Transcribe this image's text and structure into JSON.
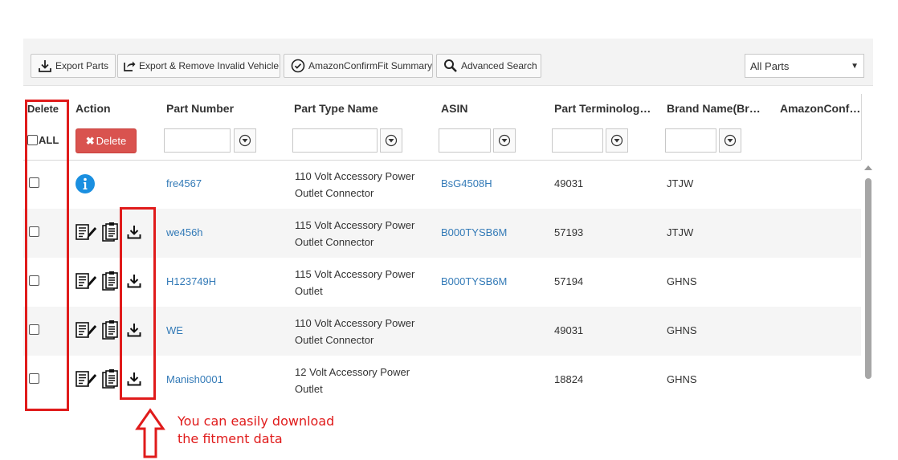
{
  "toolbar": {
    "export_parts": "Export Parts",
    "export_remove": "Export & Remove Invalid Vehicle",
    "amazon_summary": "AmazonConfirmFit Summary",
    "advanced_search": "Advanced Search",
    "filter_select": "All Parts"
  },
  "grid": {
    "columns": [
      "Delete",
      "Action",
      "Part Number",
      "Part Type Name",
      "ASIN",
      "Part Terminology…",
      "Brand Name(Bra…",
      "AmazonConfir…"
    ],
    "select_all_label": "ALL",
    "delete_button": "Delete",
    "rows": [
      {
        "part_number": "fre4567",
        "part_type": "110 Volt Accessory Power Outlet Connector",
        "asin": "BsG4508H",
        "terminology": "49031",
        "brand": "JTJW",
        "action": "info"
      },
      {
        "part_number": "we456h",
        "part_type": "115 Volt Accessory Power Outlet Connector",
        "asin": "B000TYSB6M",
        "terminology": "57193",
        "brand": "JTJW",
        "action": "tools"
      },
      {
        "part_number": "H123749H",
        "part_type": "115 Volt Accessory Power Outlet",
        "asin": "B000TYSB6M",
        "terminology": "57194",
        "brand": "GHNS",
        "action": "tools"
      },
      {
        "part_number": "WE",
        "part_type": "110 Volt Accessory Power Outlet Connector",
        "asin": "",
        "terminology": "49031",
        "brand": "GHNS",
        "action": "tools"
      },
      {
        "part_number": "Manish0001",
        "part_type": "12 Volt Accessory Power Outlet",
        "asin": "",
        "terminology": "18824",
        "brand": "GHNS",
        "action": "tools"
      }
    ]
  },
  "annotation": {
    "text": "You can easily download the fitment data",
    "color": "#e01b1b"
  },
  "colors": {
    "link": "#337ab7",
    "delete_button": "#d9534f",
    "info_icon": "#1a8fe0"
  }
}
